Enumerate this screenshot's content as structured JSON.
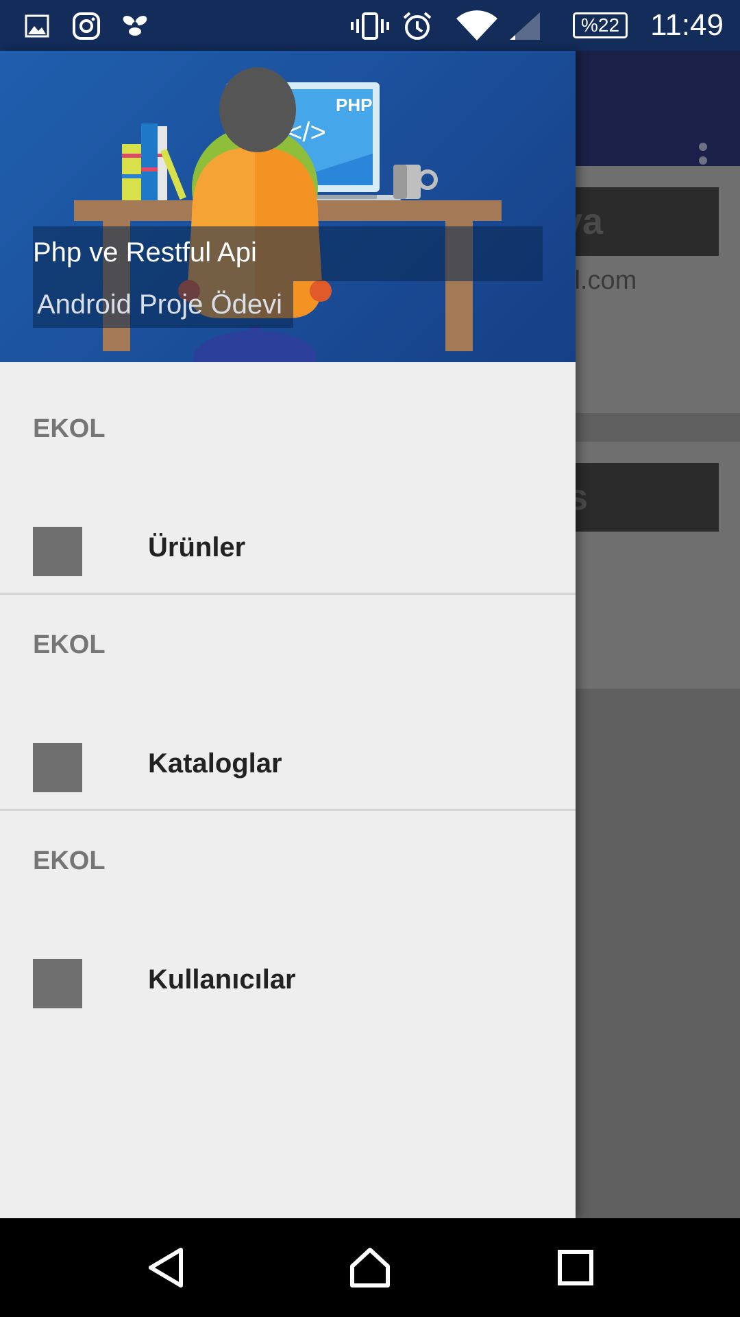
{
  "status_bar": {
    "battery": "%22",
    "time": "11:49",
    "icons": [
      "gallery-icon",
      "instagram-icon",
      "app-icon",
      "vibrate-icon",
      "alarm-icon",
      "wifi-icon",
      "signal-icon",
      "battery-icon"
    ]
  },
  "background_app": {
    "card1_text_tail": "ya",
    "email_tail": "il.com",
    "card2_text_tail": "s"
  },
  "drawer": {
    "header": {
      "title": "Php ve Restful Api",
      "subtitle": "Android Proje Ödevi",
      "art_text": "PHP",
      "art_code": "</>"
    },
    "sections": [
      {
        "header": "EKOL",
        "item": "Ürünler"
      },
      {
        "header": "EKOL",
        "item": "Kataloglar"
      },
      {
        "header": "EKOL",
        "item": "Kullanıcılar"
      }
    ]
  },
  "nav_bar": {
    "buttons": [
      "back-icon",
      "home-icon",
      "recents-icon"
    ]
  },
  "colors": {
    "status_bar": "#132c59",
    "header_blue": "#1f5fae",
    "drawer_bg": "#eeeeee",
    "toolbar": "#1a2048"
  }
}
